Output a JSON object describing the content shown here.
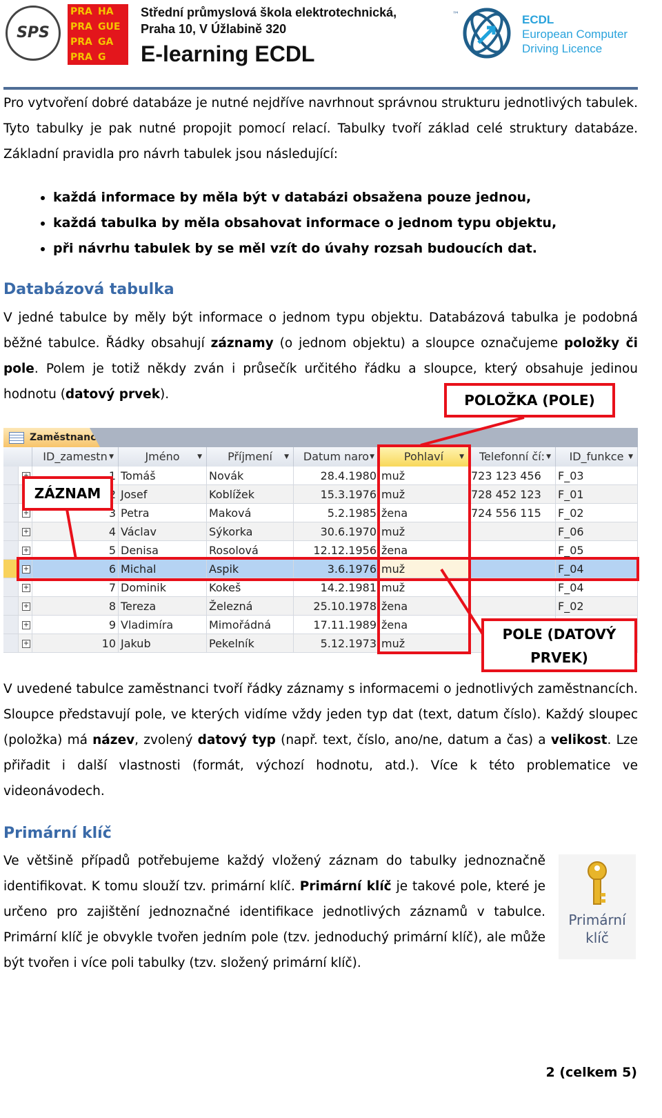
{
  "header": {
    "logo_sps": "SPS",
    "prague_logo": [
      "PRA",
      "HA",
      "PRA",
      "GUE",
      "PRA",
      "GA",
      "PRA",
      "G"
    ],
    "school_line1": "Střední průmyslová škola elektrotechnická,",
    "school_line2": "Praha 10, V Úžlabině 320",
    "title": "E-learning ECDL",
    "ecdl_tm": "™",
    "ecdl_line1": "ECDL",
    "ecdl_line2": "European Computer",
    "ecdl_line3": "Driving Licence",
    "accent": "#4f6d96"
  },
  "intro": "Pro vytvoření dobré databáze je nutné nejdříve navrhnout správnou strukturu jednotlivých tabulek. Tyto tabulky je pak nutné propojit pomocí relací. Tabulky tvoří základ celé struktury databáze. Základní pravidla pro návrh tabulek jsou následující:",
  "rules": [
    "každá informace by měla být v databázi obsažena pouze jednou,",
    "každá tabulka by měla obsahovat informace o jednom typu objektu,",
    "při návrhu tabulek by se měl vzít do úvahy rozsah budoucích dat."
  ],
  "section1": {
    "title": "Databázová tabulka",
    "p1": "V jedné tabulce by měly být informace o jednom typu objektu. Databázová tabulka je podobná běžné tabulce. Řádky obsahují ",
    "b1": "záznamy",
    "p2": " (o jednom objektu) a sloupce označujeme ",
    "b2": "položky či pole",
    "p3": ". Polem je totiž někdy zván i průsečík určitého řádku a sloupce, který obsahuje jedinou hodnotu (",
    "b3": "datový prvek",
    "p4": ")."
  },
  "table": {
    "tab": "Zaměstnanci",
    "columns": [
      "ID_zamestn",
      "Jméno",
      "Příjmení",
      "Datum naro",
      "Pohlaví",
      "Telefonní čí:",
      "ID_funkce"
    ],
    "rows": [
      [
        "1",
        "Tomáš",
        "Novák",
        "28.4.1980",
        "muž",
        "723 123 456",
        "F_03"
      ],
      [
        "2",
        "Josef",
        "Koblížek",
        "15.3.1976",
        "muž",
        "728 452 123",
        "F_01"
      ],
      [
        "3",
        "Petra",
        "Maková",
        "5.2.1985",
        "žena",
        "724 556 115",
        "F_02"
      ],
      [
        "4",
        "Václav",
        "Sýkorka",
        "30.6.1970",
        "muž",
        "",
        "F_06"
      ],
      [
        "5",
        "Denisa",
        "Rosolová",
        "12.12.1956",
        "žena",
        "",
        "F_05"
      ],
      [
        "6",
        "Michal",
        "Aspik",
        "3.6.1976",
        "muž",
        "",
        "F_04"
      ],
      [
        "7",
        "Dominik",
        "Kokeš",
        "14.2.1981",
        "muž",
        "",
        "F_04"
      ],
      [
        "8",
        "Tereza",
        "Železná",
        "25.10.1978",
        "žena",
        "",
        "F_02"
      ],
      [
        "9",
        "Vladimíra",
        "Mimořádná",
        "17.11.1989",
        "žena",
        "",
        "F_02"
      ],
      [
        "10",
        "Jakub",
        "Pekelník",
        "5.12.1973",
        "muž",
        "",
        ""
      ]
    ],
    "selected_row": 6
  },
  "callouts": {
    "field": "POLOŽKA (POLE)",
    "record": "ZÁZNAM",
    "data_item": "POLE (DATOVÝ PRVEK)",
    "color": "#e8101a"
  },
  "section1b": {
    "p1": "V uvedené tabulce zaměstnanci tvoří řádky záznamy s informacemi o jednotlivých zaměstnancích. Sloupce představují pole, ve kterých vidíme vždy jeden typ dat (text, datum číslo). Každý sloupec (položka) má ",
    "b1": "název",
    "p2": ", zvolený ",
    "b2": "datový typ",
    "p3": " (např. text, číslo, ano/ne, datum a čas) a ",
    "b3": "velikost",
    "p4": ". Lze přiřadit i další vlastnosti (formát, výchozí hodnotu, atd.). Více k této problematice ve videonávodech."
  },
  "section2": {
    "title": "Primární klíč",
    "p1": "Ve většině případů potřebujeme každý vložený záznam do tabulky jednoznačně identifikovat. K tomu slouží tzv. primární klíč. ",
    "b1": "Primární klíč",
    "p2": " je takové pole, které je určeno pro zajištění jednoznačné identifikace jednotlivých záznamů v tabulce. Primární klíč je obvykle tvořen jedním pole (tzv. jednoduchý primární klíč), ale může být tvořen i více poli tabulky (tzv. složený primární klíč).",
    "key_label1": "Primární",
    "key_label2": "klíč"
  },
  "footer": {
    "page": "2 (celkem 5)"
  }
}
